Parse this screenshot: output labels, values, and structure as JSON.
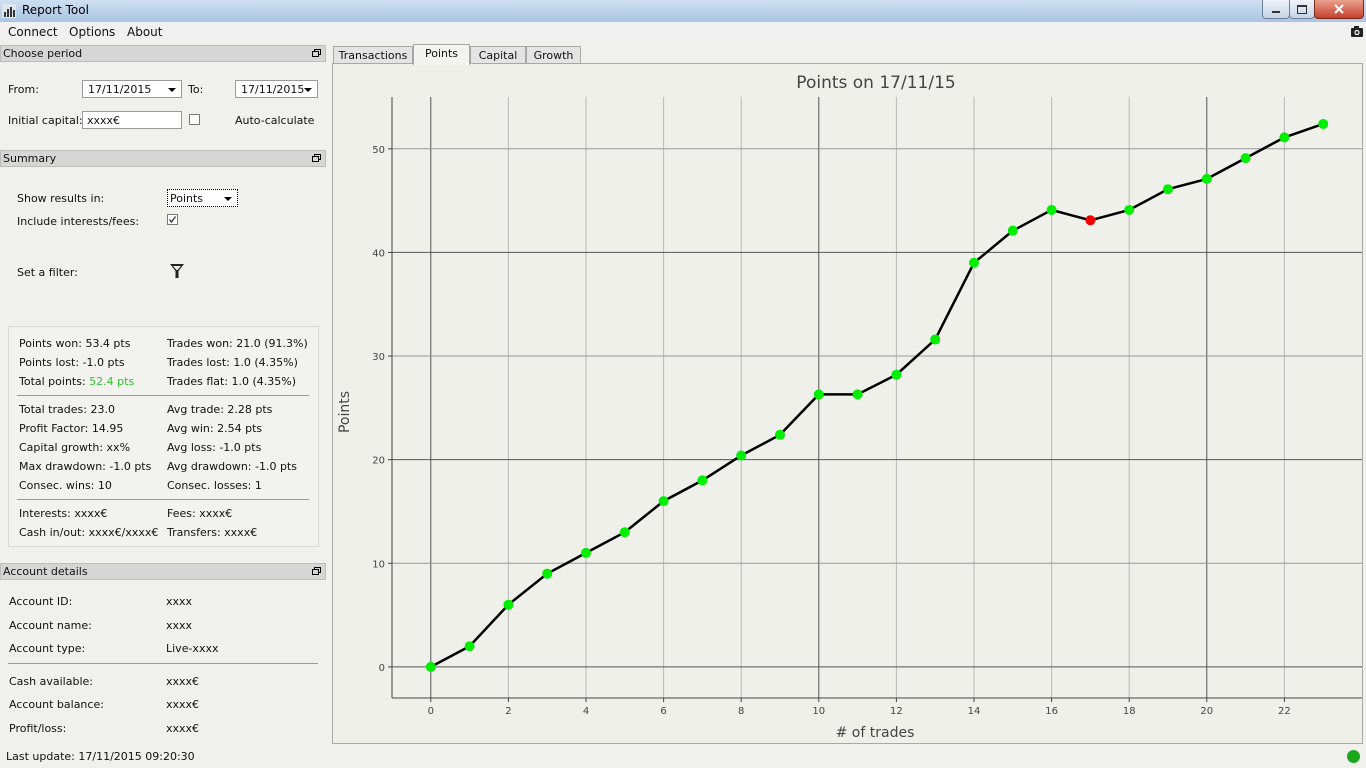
{
  "window": {
    "title": "Report Tool"
  },
  "menu": {
    "items": [
      "Connect",
      "Options",
      "About"
    ]
  },
  "period": {
    "header": "Choose period",
    "from_label": "From:",
    "from_value": "17/11/2015",
    "to_label": "To:",
    "to_value": "17/11/2015",
    "capital_label": "Initial capital:",
    "capital_value": "xxxx€",
    "auto_label": "Auto-calculate"
  },
  "summary": {
    "header": "Summary",
    "show_results_label": "Show results in:",
    "show_results_value": "Points",
    "include_label": "Include interests/fees:",
    "filter_label": "Set a filter:",
    "stats": {
      "points_won": "Points won: 53.4 pts",
      "points_lost": "Points lost: -1.0 pts",
      "total_points_label": "Total points: ",
      "total_points_value": "52.4 pts",
      "trades_won": "Trades won: 21.0 (91.3%)",
      "trades_lost": "Trades lost: 1.0 (4.35%)",
      "trades_flat": "Trades flat: 1.0 (4.35%)",
      "total_trades": "Total trades: 23.0",
      "profit_factor": "Profit Factor: 14.95",
      "capital_growth": "Capital growth: xx%",
      "max_drawdown": "Max drawdown: -1.0 pts",
      "consec_wins": "Consec. wins: 10",
      "avg_trade": "Avg trade: 2.28 pts",
      "avg_win": "Avg win: 2.54 pts",
      "avg_loss": "Avg loss: -1.0 pts",
      "avg_drawdown": "Avg drawdown: -1.0 pts",
      "consec_losses": "Consec. losses: 1",
      "interests": "Interests: xxxx€",
      "cash_inout": "Cash in/out: xxxx€/xxxx€",
      "fees": "Fees: xxxx€",
      "transfers": "Transfers: xxxx€"
    }
  },
  "account": {
    "header": "Account details",
    "rows": [
      {
        "label": "Account ID:",
        "value": "xxxx"
      },
      {
        "label": "Account name:",
        "value": "xxxx"
      },
      {
        "label": "Account type:",
        "value": "Live-xxxx"
      },
      {
        "label": "Cash available:",
        "value": "xxxx€"
      },
      {
        "label": "Account balance:",
        "value": "xxxx€"
      },
      {
        "label": "Profit/loss:",
        "value": "xxxx€"
      }
    ]
  },
  "tabs": [
    "Transactions",
    "Points",
    "Capital",
    "Growth"
  ],
  "active_tab": "Points",
  "status": {
    "last_update": "Last update: 17/11/2015 09:20:30",
    "connection_color": "#1aa81a"
  },
  "colors": {
    "positive_text": "#2fc42f",
    "win_point": "#00ee00",
    "loss_point": "#ee0000"
  },
  "chart_data": {
    "type": "line",
    "title": "Points on 17/11/15",
    "xlabel": "# of trades",
    "ylabel": "Points",
    "xlim": [
      -1,
      24
    ],
    "ylim": [
      -3,
      55
    ],
    "xticks": [
      0,
      2,
      4,
      6,
      8,
      10,
      12,
      14,
      16,
      18,
      20,
      22
    ],
    "yticks": [
      0,
      10,
      20,
      30,
      40,
      50
    ],
    "grid": true,
    "x": [
      0,
      1,
      2,
      3,
      4,
      5,
      6,
      7,
      8,
      9,
      10,
      11,
      12,
      13,
      14,
      15,
      16,
      17,
      18,
      19,
      20,
      21,
      22,
      23
    ],
    "values": [
      0,
      2,
      6,
      9,
      11,
      13,
      16,
      18,
      20.4,
      22.4,
      26.3,
      26.3,
      28.2,
      31.6,
      39,
      42.1,
      44.1,
      43.1,
      44.1,
      46.1,
      47.1,
      49.1,
      51.1,
      52.4
    ],
    "loss_points": [
      17
    ]
  }
}
